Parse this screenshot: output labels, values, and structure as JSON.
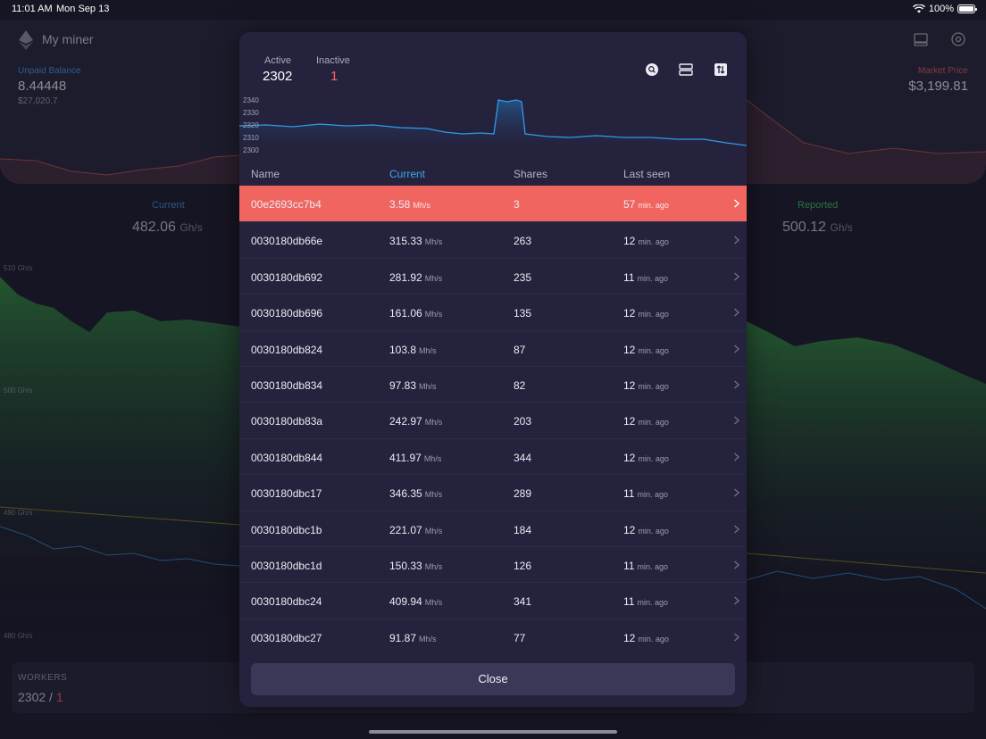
{
  "status_bar": {
    "time": "11:01 AM",
    "date": "Mon Sep 13",
    "battery": "100%"
  },
  "nav": {
    "title": "My miner",
    "icons": [
      "ethereum-logo",
      "server-icon",
      "settings-icon"
    ]
  },
  "summary": {
    "unpaid_label": "Unpaid Balance",
    "unpaid_value": "8.44448",
    "unpaid_usd": "$27,020.7",
    "market_label": "Market Price",
    "market_value": "$3,199.81"
  },
  "stats": {
    "current_label": "Current",
    "current_value": "482.06",
    "current_unit": "Gh/s",
    "reported_label": "Reported",
    "reported_value": "500.12",
    "reported_unit": "Gh/s"
  },
  "main_chart_axis": [
    "510 Gh/s",
    "500 Gh/s",
    "490 Gh/s",
    "480 Gh/s"
  ],
  "workers_card": {
    "label": "WORKERS",
    "active": "2302",
    "separator": " / ",
    "inactive": "1"
  },
  "modal": {
    "active_label": "Active",
    "active_value": "2302",
    "inactive_label": "Inactive",
    "inactive_value": "1",
    "icons": [
      "search-icon",
      "layout-icon",
      "sort-icon"
    ],
    "chart_y_labels": [
      "2340",
      "2330",
      "2320",
      "2310",
      "2300"
    ],
    "columns": {
      "name": "Name",
      "current": "Current",
      "shares": "Shares",
      "last_seen": "Last seen"
    },
    "rows": [
      {
        "name": "00e2693cc7b4",
        "current": "3.58",
        "unit": "Mh/s",
        "shares": "3",
        "seen": "57",
        "seen_unit": "min. ago"
      },
      {
        "name": "0030180db66e",
        "current": "315.33",
        "unit": "Mh/s",
        "shares": "263",
        "seen": "12",
        "seen_unit": "min. ago"
      },
      {
        "name": "0030180db692",
        "current": "281.92",
        "unit": "Mh/s",
        "shares": "235",
        "seen": "11",
        "seen_unit": "min. ago"
      },
      {
        "name": "0030180db696",
        "current": "161.06",
        "unit": "Mh/s",
        "shares": "135",
        "seen": "12",
        "seen_unit": "min. ago"
      },
      {
        "name": "0030180db824",
        "current": "103.8",
        "unit": "Mh/s",
        "shares": "87",
        "seen": "12",
        "seen_unit": "min. ago"
      },
      {
        "name": "0030180db834",
        "current": "97.83",
        "unit": "Mh/s",
        "shares": "82",
        "seen": "12",
        "seen_unit": "min. ago"
      },
      {
        "name": "0030180db83a",
        "current": "242.97",
        "unit": "Mh/s",
        "shares": "203",
        "seen": "12",
        "seen_unit": "min. ago"
      },
      {
        "name": "0030180db844",
        "current": "411.97",
        "unit": "Mh/s",
        "shares": "344",
        "seen": "12",
        "seen_unit": "min. ago"
      },
      {
        "name": "0030180dbc17",
        "current": "346.35",
        "unit": "Mh/s",
        "shares": "289",
        "seen": "11",
        "seen_unit": "min. ago"
      },
      {
        "name": "0030180dbc1b",
        "current": "221.07",
        "unit": "Mh/s",
        "shares": "184",
        "seen": "12",
        "seen_unit": "min. ago"
      },
      {
        "name": "0030180dbc1d",
        "current": "150.33",
        "unit": "Mh/s",
        "shares": "126",
        "seen": "11",
        "seen_unit": "min. ago"
      },
      {
        "name": "0030180dbc24",
        "current": "409.94",
        "unit": "Mh/s",
        "shares": "341",
        "seen": "11",
        "seen_unit": "min. ago"
      },
      {
        "name": "0030180dbc27",
        "current": "91.87",
        "unit": "Mh/s",
        "shares": "77",
        "seen": "12",
        "seen_unit": "min. ago"
      }
    ],
    "close_label": "Close"
  },
  "colors": {
    "accent_blue": "#3aa9f0",
    "alert_red": "#f06560",
    "chart_green": "#2f8a3a",
    "background": "#161523",
    "modal": "#25223d"
  }
}
